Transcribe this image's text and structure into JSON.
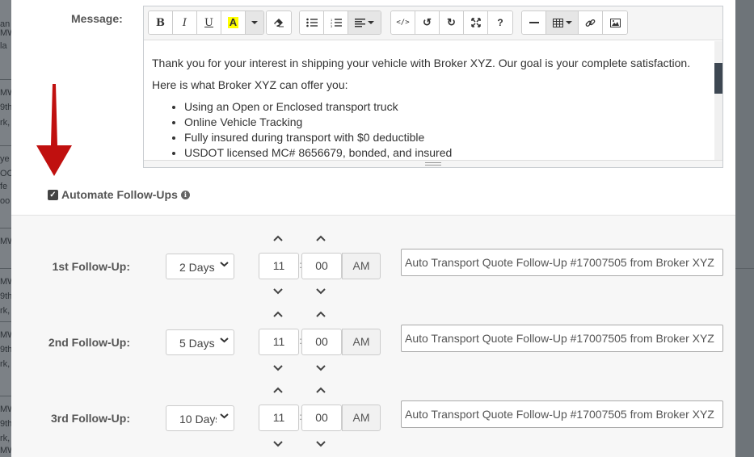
{
  "background": {
    "left_fragments": [
      "an",
      "MW",
      "la",
      "MW",
      "9th",
      "rk,",
      "ye",
      "OC",
      "fe",
      "oo",
      "MW",
      "la",
      "MW",
      "9th",
      "rk,",
      "MW",
      "9th",
      "rk,",
      "MW",
      "9th",
      "rk,",
      "MW"
    ]
  },
  "message": {
    "label": "Message:",
    "toolbar": {
      "groups": [
        [
          {
            "icon": "bold-icon",
            "glyph": "B"
          },
          {
            "icon": "italic-icon",
            "glyph": "I"
          },
          {
            "icon": "underline-icon",
            "glyph": "U"
          },
          {
            "icon": "highlight-icon",
            "glyph": "A"
          },
          {
            "icon": "chevron-down-icon",
            "glyph": ""
          }
        ],
        [
          {
            "icon": "eraser-icon",
            "glyph": ""
          }
        ],
        [
          {
            "icon": "bullet-list-icon",
            "glyph": ""
          },
          {
            "icon": "numbered-list-icon",
            "glyph": ""
          },
          {
            "icon": "align-icon",
            "glyph": ""
          }
        ],
        [
          {
            "icon": "code-view-icon",
            "glyph": "</>"
          },
          {
            "icon": "undo-icon",
            "glyph": "↺"
          },
          {
            "icon": "redo-icon",
            "glyph": "↻"
          },
          {
            "icon": "fullscreen-icon",
            "glyph": ""
          },
          {
            "icon": "help-icon",
            "glyph": "?"
          }
        ],
        [
          {
            "icon": "horizontal-rule-icon",
            "glyph": ""
          },
          {
            "icon": "table-icon",
            "glyph": ""
          },
          {
            "icon": "link-icon",
            "glyph": ""
          },
          {
            "icon": "image-icon",
            "glyph": ""
          }
        ]
      ]
    },
    "body": {
      "intro": "Thank you for your interest in shipping your vehicle with Broker XYZ. Our goal is your complete satisfaction.",
      "offer": "Here is what Broker XYZ can offer you:",
      "bullets": [
        "Using an Open or Enclosed transport truck",
        "Online Vehicle Tracking",
        "Fully insured during transport with $0 deductible",
        "USDOT licensed MC# 8656679, bonded, and insured"
      ]
    }
  },
  "automate": {
    "label": "Automate Follow-Ups",
    "checked": true,
    "check_glyph": "✓",
    "info_glyph": "i"
  },
  "followups": [
    {
      "label": "1st Follow-Up:",
      "days": "2 Days",
      "hour": "11",
      "minute": "00",
      "ampm": "AM",
      "subject": "Auto Transport Quote  Follow-Up #17007505 from Broker XYZ"
    },
    {
      "label": "2nd Follow-Up:",
      "days": "5 Days",
      "hour": "11",
      "minute": "00",
      "ampm": "AM",
      "subject": "Auto Transport Quote  Follow-Up #17007505 from Broker XYZ"
    },
    {
      "label": "3rd Follow-Up:",
      "days": "10 Days",
      "hour": "11",
      "minute": "00",
      "ampm": "AM",
      "subject": "Auto Transport Quote  Follow-Up #17007505 from Broker XYZ"
    }
  ],
  "time_separator": ":",
  "colors": {
    "arrow": "#c0100f",
    "scroll_thumb": "#3d4752",
    "highlight": "#ffff00"
  }
}
